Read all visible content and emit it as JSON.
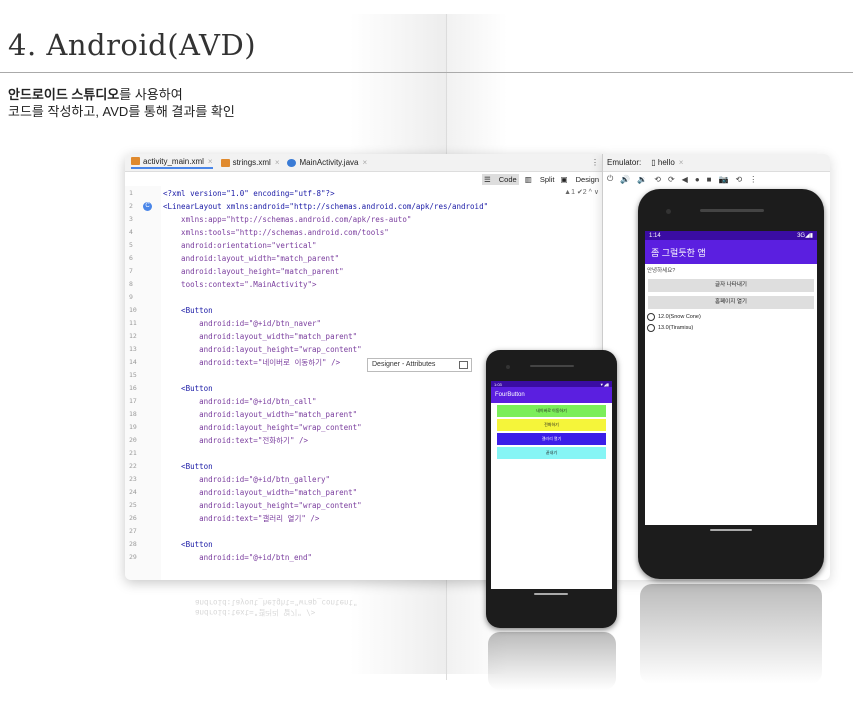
{
  "slide": {
    "title": "4. Android(AVD)",
    "subtitle_bold": "안드로이드 스튜디오",
    "subtitle_rest": "를 사용하여",
    "subtitle_line2": "코드를 작성하고, AVD를 통해 결과를 확인"
  },
  "ide": {
    "tabs": [
      {
        "label": "activity_main.xml",
        "icon": "xml-file-icon"
      },
      {
        "label": "strings.xml",
        "icon": "xml-file-icon"
      },
      {
        "label": "MainActivity.java",
        "icon": "java-class-icon"
      }
    ],
    "modes": {
      "code": "Code",
      "split": "Split",
      "design": "Design"
    },
    "warnings": "▲1 ✔2 ^ ∨",
    "popup": "Designer - Attributes",
    "lines": [
      {
        "n": "1",
        "t": "<?xml version=\"1.0\" encoding=\"utf-8\"?>"
      },
      {
        "n": "2",
        "t": "<LinearLayout xmlns:android=\"http://schemas.android.com/apk/res/android\""
      },
      {
        "n": "3",
        "t": "    xmlns:app=\"http://schemas.android.com/apk/res-auto\""
      },
      {
        "n": "4",
        "t": "    xmlns:tools=\"http://schemas.android.com/tools\""
      },
      {
        "n": "5",
        "t": "    android:orientation=\"vertical\""
      },
      {
        "n": "6",
        "t": "    android:layout_width=\"match_parent\""
      },
      {
        "n": "7",
        "t": "    android:layout_height=\"match_parent\""
      },
      {
        "n": "8",
        "t": "    tools:context=\".MainActivity\">"
      },
      {
        "n": "9",
        "t": ""
      },
      {
        "n": "10",
        "t": "    <Button"
      },
      {
        "n": "11",
        "t": "        android:id=\"@+id/btn_naver\""
      },
      {
        "n": "12",
        "t": "        android:layout_width=\"match_parent\""
      },
      {
        "n": "13",
        "t": "        android:layout_height=\"wrap_content\""
      },
      {
        "n": "14",
        "t": "        android:text=\"네이버로 이동하기\" />"
      },
      {
        "n": "15",
        "t": ""
      },
      {
        "n": "16",
        "t": "    <Button"
      },
      {
        "n": "17",
        "t": "        android:id=\"@+id/btn_call\""
      },
      {
        "n": "18",
        "t": "        android:layout_width=\"match_parent\""
      },
      {
        "n": "19",
        "t": "        android:layout_height=\"wrap_content\""
      },
      {
        "n": "20",
        "t": "        android:text=\"전화하기\" />"
      },
      {
        "n": "21",
        "t": ""
      },
      {
        "n": "22",
        "t": "    <Button"
      },
      {
        "n": "23",
        "t": "        android:id=\"@+id/btn_gallery\""
      },
      {
        "n": "24",
        "t": "        android:layout_width=\"match_parent\""
      },
      {
        "n": "25",
        "t": "        android:layout_height=\"wrap_content\""
      },
      {
        "n": "26",
        "t": "        android:text=\"갤러리 열기\" />"
      },
      {
        "n": "27",
        "t": ""
      },
      {
        "n": "28",
        "t": "    <Button"
      },
      {
        "n": "29",
        "t": "        android:id=\"@+id/btn_end\""
      }
    ]
  },
  "emulator": {
    "label": "Emulator:",
    "device": "hello",
    "tools": [
      "⏻",
      "🔊",
      "🔉",
      "⟲",
      "⟳",
      "◀",
      "●",
      "■",
      "📷",
      "⟲",
      "⋮"
    ]
  },
  "phone_small": {
    "status_time": "1:03",
    "status_right": "▼◢▮",
    "app_title": "FourButton",
    "buttons": [
      {
        "label": "네이버로 이동하기",
        "color": "#7bee5a"
      },
      {
        "label": "전화하기",
        "color": "#f5f53a"
      },
      {
        "label": "갤러리 열기",
        "color": "#3b1ee8"
      },
      {
        "label": "끝내기",
        "color": "#86f5f5"
      }
    ]
  },
  "phone_large": {
    "status_time": "1:14",
    "status_right": "3G◢▮",
    "app_title": "좀 그럴듯한 앱",
    "greeting": "안녕하세요?",
    "buttons": [
      "글자 나타내기",
      "홈페이지 열기"
    ],
    "radios": [
      "12.0(Snow Cone)",
      "13.0(Tiramisu)"
    ]
  },
  "colors": {
    "status_bar": "#3a0ca3",
    "app_bar": "#5b1fe0",
    "accent_link": "#4a86e8"
  }
}
